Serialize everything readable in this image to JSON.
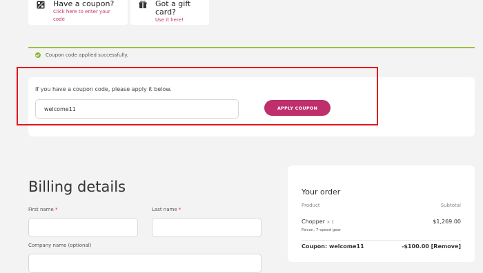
{
  "top_cards": {
    "coupon": {
      "title": "Have a coupon?",
      "link": "Click here to enter your code",
      "icon": "coupon-icon"
    },
    "gift": {
      "title": "Got a gift card?",
      "link": "Use it here!",
      "icon": "gift-card-icon"
    }
  },
  "notice": {
    "message": "Coupon code applied successfully.",
    "icon": "check-circle-icon",
    "color": "#9cbf3f"
  },
  "coupon_form": {
    "hint": "If you have a coupon code, please apply it below.",
    "input_value": "welcome11",
    "button_label": "APPLY COUPON",
    "button_color": "#be2f6b"
  },
  "billing": {
    "title": "Billing details",
    "first_name_label": "First name",
    "last_name_label": "Last name",
    "required_mark": "*",
    "company_label": "Company name (optional)"
  },
  "order": {
    "title": "Your order",
    "col_product": "Product",
    "col_subtotal": "Subtotal",
    "item_name": "Chopper",
    "item_qty": "× 1",
    "item_variant": "Falcon, 7-speed gear",
    "item_price": "$1,269.00",
    "coupon_label": "Coupon: welcome11",
    "coupon_discount": "-$100.00",
    "remove_label": "[Remove]"
  },
  "colors": {
    "accent": "#be2f6b",
    "link": "#c0306a",
    "success": "#8fb63a",
    "highlight": "#e3131b"
  }
}
